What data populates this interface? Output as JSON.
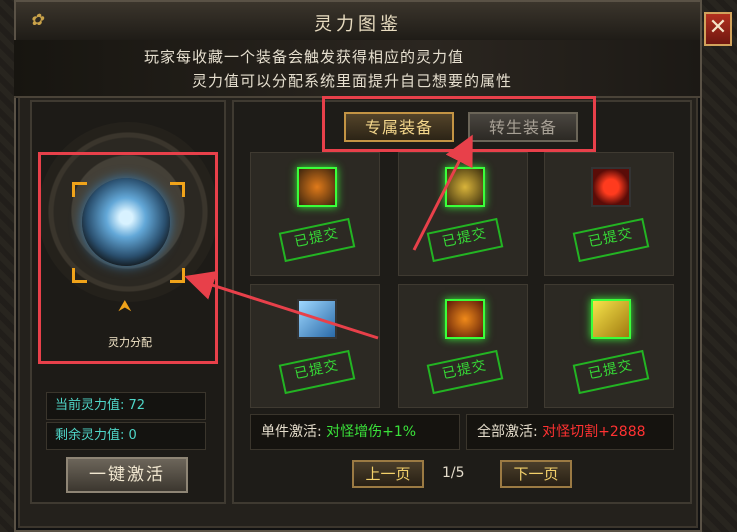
{
  "window": {
    "title": "灵力图鉴",
    "close_label": "✕"
  },
  "description": {
    "line1": "玩家每收藏一个装备会触发获得相应的灵力值",
    "line2": "灵力值可以分配系统里面提升自己想要的属性"
  },
  "left_panel": {
    "allocate_label": "灵力分配",
    "current_label": "当前灵力值: ",
    "current_value": "72",
    "remaining_label": "剩余灵力值: ",
    "remaining_value": "0",
    "activate_all_button": "一键激活"
  },
  "tabs": [
    {
      "label": "专属装备",
      "selected": true
    },
    {
      "label": "转生装备",
      "selected": false
    }
  ],
  "items": [
    {
      "icon": "blade-fang-icon",
      "status": "已提交"
    },
    {
      "icon": "golden-armor-icon",
      "status": "已提交"
    },
    {
      "icon": "red-ring-icon",
      "status": "已提交"
    },
    {
      "icon": "blue-sword-icon",
      "status": "已提交"
    },
    {
      "icon": "fire-medal-icon",
      "status": "已提交"
    },
    {
      "icon": "yellow-scroll-icon",
      "status": "已提交"
    }
  ],
  "activation": {
    "single_label": "单件激活: ",
    "single_value": "对怪增伤+1%",
    "all_label": "全部激活: ",
    "all_value": "对怪切割+2888"
  },
  "pagination": {
    "prev_label": "上一页",
    "page": "1/5",
    "next_label": "下一页"
  },
  "colors": {
    "highlight_red": "#e8404a",
    "active_green": "#3ae23a",
    "value_red": "#ff3232",
    "stat_cyan": "#4fd6c8"
  }
}
